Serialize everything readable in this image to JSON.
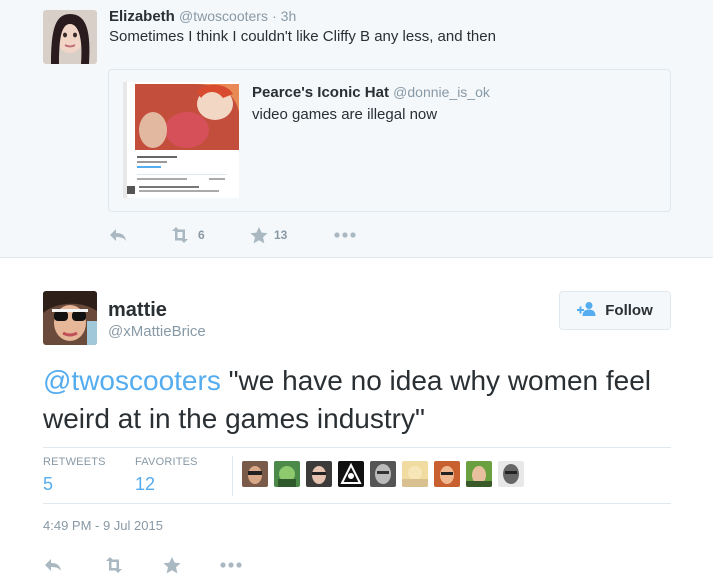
{
  "parent": {
    "name": "Elizabeth",
    "handle": "@twoscooters",
    "time": "· 3h",
    "text": "Sometimes I think I couldn't like Cliffy B any less, and then",
    "quote": {
      "name": "Pearce's Iconic Hat",
      "handle": "@donnie_is_ok",
      "text": "video games are illegal now"
    },
    "actions": {
      "retweet_count": "6",
      "favorite_count": "13"
    }
  },
  "main": {
    "name": "mattie",
    "handle": "@xMattieBrice",
    "follow_label": "Follow",
    "mention": "@twoscooters",
    "text": " \"we have no idea why women feel weird at in the games industry\"",
    "stats": {
      "retweets_label": "RETWEETS",
      "retweets_value": "5",
      "favorites_label": "FAVORITES",
      "favorites_value": "12"
    },
    "timestamp": "4:49 PM - 9 Jul 2015"
  },
  "colors": {
    "link": "#55acee",
    "muted": "#8899a6",
    "action_icon": "#aab8c2",
    "background_alt": "#f5f8fa"
  },
  "icons": [
    "reply-icon",
    "retweet-icon",
    "favorite-star-icon",
    "more-dots-icon",
    "add-user-icon"
  ]
}
